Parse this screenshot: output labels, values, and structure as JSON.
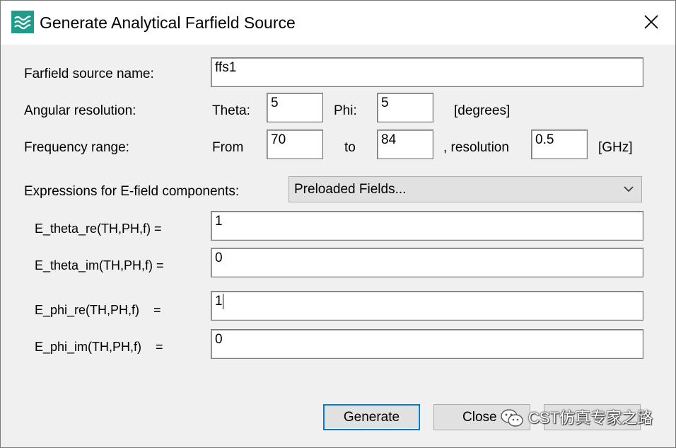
{
  "window": {
    "title": "Generate Analytical Farfield Source",
    "icon": "waves-icon",
    "accent_color": "#1f9d8a"
  },
  "form": {
    "name_label": "Farfield source name:",
    "name_value": "ffs1",
    "angular_label": "Angular resolution:",
    "theta_label": "Theta:",
    "theta_value": "5",
    "phi_label": "Phi:",
    "phi_value": "5",
    "angle_unit": "[degrees]",
    "freq_label": "Frequency range:",
    "from_label": "From",
    "from_value": "70",
    "to_label": "to",
    "to_value": "84",
    "resolution_label": ", resolution",
    "resolution_value": "0.5",
    "freq_unit": "[GHz]",
    "expressions_label": "Expressions for E-field components:",
    "preloaded_value": "Preloaded Fields..."
  },
  "expressions": [
    {
      "label": "E_theta_re(TH,PH,f)  =",
      "value": "1"
    },
    {
      "label": "E_theta_im(TH,PH,f)  =",
      "value": "0"
    },
    {
      "label": "E_phi_re(TH,PH,f)    =",
      "value": "1"
    },
    {
      "label": "E_phi_im(TH,PH,f)    =",
      "value": "0"
    }
  ],
  "buttons": {
    "generate": "Generate",
    "close": "Close"
  },
  "watermark": {
    "text": "CST仿真专家之路"
  }
}
